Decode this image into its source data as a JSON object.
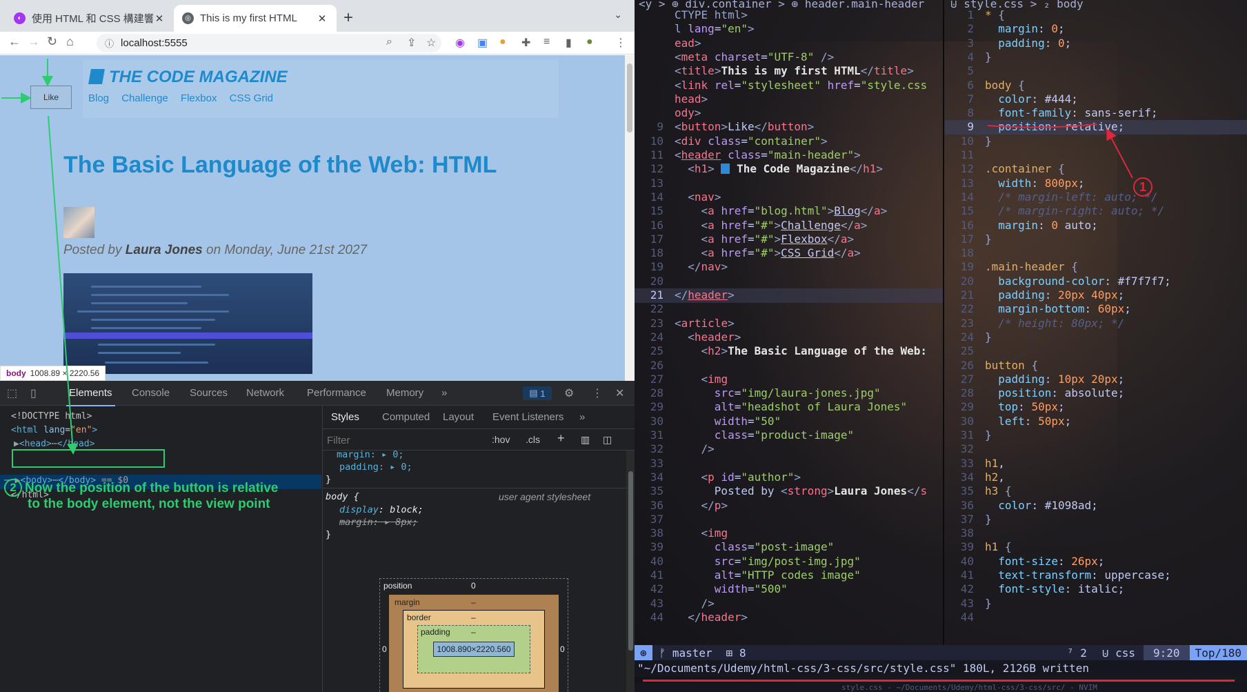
{
  "browser": {
    "tabs": [
      {
        "title": "使用 HTML 和 CSS 構建響",
        "close": "✕",
        "active": false
      },
      {
        "title": "This is my first HTML",
        "close": "✕",
        "active": true
      }
    ],
    "new_tab": "+",
    "tab_menu": "⌄",
    "url": "localhost:5555",
    "page": {
      "magazine_title": "The Code Magazine",
      "nav": [
        "Blog",
        "Challenge",
        "Flexbox",
        "CSS Grid"
      ],
      "like_button": "Like",
      "post_title": "The Basic Language of the Web: HTML",
      "posted_by": "Posted by",
      "author": "Laura Jones",
      "posted_on": "on Monday, June 21st 2027",
      "element_tooltip_tag": "body",
      "element_tooltip_size": "1008.89 × 2220.56"
    },
    "devtools": {
      "tabs": [
        "Elements",
        "Console",
        "Sources",
        "Network",
        "Performance",
        "Memory"
      ],
      "more": "»",
      "issues_count": "1",
      "dom": {
        "doctype": "<!DOCTYPE html>",
        "html_open_tag": "html",
        "html_lang_attr": "lang",
        "html_lang_value": "\"en\"",
        "head_tag": "head",
        "body_tag": "body",
        "body_suffix": "== $0",
        "html_close": "</html>"
      },
      "annotation_2_line1": "Now the position of the button is relative",
      "annotation_2_line2": "to the body element, not the view point",
      "annotation_2_num": "2",
      "styles_tabs": [
        "Styles",
        "Computed",
        "Layout",
        "Event Listeners"
      ],
      "filter_placeholder": "Filter",
      "hov": ":hov",
      "cls": ".cls",
      "rules": {
        "prev_margin": "margin: ▸ 0;",
        "prev_padding": "padding: ▸ 0;",
        "close": "}",
        "body_selector": "body {",
        "uas_label": "user agent stylesheet",
        "display_prop": "display",
        "display_val": "block;",
        "margin_struck": "margin: ▸ 8px;"
      },
      "box_model": {
        "position_label": "position",
        "position_value": "0",
        "margin_label": "margin",
        "border_label": "border",
        "padding_label": "padding",
        "dash": "–",
        "content": "1008.890×2220.560",
        "left_value": "0",
        "right_value": "0",
        "bottom_value": "0"
      }
    }
  },
  "editor": {
    "left_winbar": "<y > ⊕ div.container > ⊕ header.main-header",
    "right_winbar": "⊍ style.css > ₂ body",
    "html_lines": [
      {
        "n": "",
        "html": "<span class='c-br'>CTYPE html&gt;</span>"
      },
      {
        "n": "",
        "html": "<span class='c-br'>l</span> <span class='c-attr'>lang</span>=<span class='c-str'>\"en\"</span><span class='c-br'>&gt;</span>"
      },
      {
        "n": "",
        "html": "<span class='c-tag'>ead</span><span class='c-br'>&gt;</span>"
      },
      {
        "n": "",
        "html": "<span class='c-br'>&lt;</span><span class='c-tag'>meta</span> <span class='c-attr'>charset</span>=<span class='c-str'>\"UTF-8\"</span> <span class='c-br'>/&gt;</span>"
      },
      {
        "n": "",
        "html": "<span class='c-br'>&lt;</span><span class='c-tag'>title</span><span class='c-br'>&gt;</span><span class='c-text'>This is my first HTML</span><span class='c-br'>&lt;/</span><span class='c-tag'>title</span><span class='c-br'>&gt;</span>"
      },
      {
        "n": "",
        "html": "<span class='c-br'>&lt;</span><span class='c-tag'>link</span> <span class='c-attr'>rel</span>=<span class='c-str'>\"stylesheet\"</span> <span class='c-attr'>href</span>=<span class='c-str'>\"style.css</span>"
      },
      {
        "n": "",
        "html": "<span class='c-tag'>head</span><span class='c-br'>&gt;</span>"
      },
      {
        "n": "",
        "html": "<span class='c-tag'>ody</span><span class='c-br'>&gt;</span>"
      },
      {
        "n": "9",
        "html": "<span class='c-br'>&lt;</span><span class='c-tag'>button</span><span class='c-br'>&gt;</span><span class='c-kw'>Like</span><span class='c-br'>&lt;/</span><span class='c-tag'>button</span><span class='c-br'>&gt;</span>"
      },
      {
        "n": "10",
        "html": "<span class='c-br'>&lt;</span><span class='c-tag'>div</span> <span class='c-attr'>class</span>=<span class='c-str'>\"container\"</span><span class='c-br'>&gt;</span>"
      },
      {
        "n": "11",
        "html": "<span class='c-br'>&lt;</span><span class='c-tag' style='text-decoration:underline'>header</span> <span class='c-attr'>class</span>=<span class='c-str'>\"main-header\"</span><span class='c-br'>&gt;</span>"
      },
      {
        "n": "12",
        "html": "&nbsp;&nbsp;<span class='c-br'>&lt;</span><span class='c-tag'>h1</span><span class='c-br'>&gt;</span> <span style='display:inline-block;width:13px;height:15px;background:#2e8ad8;vertical-align:-2px'></span> <span class='c-text'>The Code Magazine</span><span class='c-br'>&lt;/</span><span class='c-tag'>h1</span><span class='c-br'>&gt;</span>"
      },
      {
        "n": "13",
        "html": ""
      },
      {
        "n": "14",
        "html": "&nbsp;&nbsp;<span class='c-br'>&lt;</span><span class='c-tag'>nav</span><span class='c-br'>&gt;</span>"
      },
      {
        "n": "15",
        "html": "&nbsp;&nbsp;&nbsp;&nbsp;<span class='c-br'>&lt;</span><span class='c-tag'>a</span> <span class='c-attr'>href</span>=<span class='c-str'>\"blog.html\"</span><span class='c-br'>&gt;</span><span class='c-link'>Blog</span><span class='c-br'>&lt;/</span><span class='c-tag'>a</span><span class='c-br'>&gt;</span>"
      },
      {
        "n": "16",
        "html": "&nbsp;&nbsp;&nbsp;&nbsp;<span class='c-br'>&lt;</span><span class='c-tag'>a</span> <span class='c-attr'>href</span>=<span class='c-str'>\"#\"</span><span class='c-br'>&gt;</span><span class='c-link'>Challenge</span><span class='c-br'>&lt;/</span><span class='c-tag'>a</span><span class='c-br'>&gt;</span>"
      },
      {
        "n": "17",
        "html": "&nbsp;&nbsp;&nbsp;&nbsp;<span class='c-br'>&lt;</span><span class='c-tag'>a</span> <span class='c-attr'>href</span>=<span class='c-str'>\"#\"</span><span class='c-br'>&gt;</span><span class='c-link'>Flexbox</span><span class='c-br'>&lt;/</span><span class='c-tag'>a</span><span class='c-br'>&gt;</span>"
      },
      {
        "n": "18",
        "html": "&nbsp;&nbsp;&nbsp;&nbsp;<span class='c-br'>&lt;</span><span class='c-tag'>a</span> <span class='c-attr'>href</span>=<span class='c-str'>\"#\"</span><span class='c-br'>&gt;</span><span class='c-link'>CSS Grid</span><span class='c-br'>&lt;/</span><span class='c-tag'>a</span><span class='c-br'>&gt;</span>"
      },
      {
        "n": "19",
        "html": "&nbsp;&nbsp;<span class='c-br'>&lt;/</span><span class='c-tag'>nav</span><span class='c-br'>&gt;</span>"
      },
      {
        "n": "20",
        "html": ""
      },
      {
        "n": "21",
        "html": "<span class='c-br'>&lt;/</span><span class='c-tag' style='text-decoration:underline'>header</span><span class='c-br'>&gt;</span>",
        "cur": true
      },
      {
        "n": "22",
        "html": ""
      },
      {
        "n": "23",
        "html": "<span class='c-br'>&lt;</span><span class='c-tag'>article</span><span class='c-br'>&gt;</span>"
      },
      {
        "n": "24",
        "html": "&nbsp;&nbsp;<span class='c-br'>&lt;</span><span class='c-tag'>header</span><span class='c-br'>&gt;</span>"
      },
      {
        "n": "25",
        "html": "&nbsp;&nbsp;&nbsp;&nbsp;<span class='c-br'>&lt;</span><span class='c-tag'>h2</span><span class='c-br'>&gt;</span><span class='c-text'>The Basic Language of the Web:</span>"
      },
      {
        "n": "26",
        "html": ""
      },
      {
        "n": "27",
        "html": "&nbsp;&nbsp;&nbsp;&nbsp;<span class='c-br'>&lt;</span><span class='c-tag'>img</span>"
      },
      {
        "n": "28",
        "html": "&nbsp;&nbsp;&nbsp;&nbsp;&nbsp;&nbsp;<span class='c-attr'>src</span>=<span class='c-str'>\"img/laura-jones.jpg\"</span>"
      },
      {
        "n": "29",
        "html": "&nbsp;&nbsp;&nbsp;&nbsp;&nbsp;&nbsp;<span class='c-attr'>alt</span>=<span class='c-str'>\"headshot of Laura Jones\"</span>"
      },
      {
        "n": "30",
        "html": "&nbsp;&nbsp;&nbsp;&nbsp;&nbsp;&nbsp;<span class='c-attr'>width</span>=<span class='c-str'>\"50\"</span>"
      },
      {
        "n": "31",
        "html": "&nbsp;&nbsp;&nbsp;&nbsp;&nbsp;&nbsp;<span class='c-attr'>class</span>=<span class='c-str'>\"product-image\"</span>"
      },
      {
        "n": "32",
        "html": "&nbsp;&nbsp;&nbsp;&nbsp;<span class='c-br'>/&gt;</span>"
      },
      {
        "n": "33",
        "html": ""
      },
      {
        "n": "34",
        "html": "&nbsp;&nbsp;&nbsp;&nbsp;<span class='c-br'>&lt;</span><span class='c-tag'>p</span> <span class='c-attr'>id</span>=<span class='c-str'>\"author\"</span><span class='c-br'>&gt;</span>"
      },
      {
        "n": "35",
        "html": "&nbsp;&nbsp;&nbsp;&nbsp;&nbsp;&nbsp;<span class='c-kw'>Posted by</span> <span class='c-br'>&lt;</span><span class='c-tag'>strong</span><span class='c-br'>&gt;</span><span class='c-text'>Laura Jones</span><span class='c-br'>&lt;/</span><span class='c-tag'>s</span>"
      },
      {
        "n": "36",
        "html": "&nbsp;&nbsp;&nbsp;&nbsp;<span class='c-br'>&lt;/</span><span class='c-tag'>p</span><span class='c-br'>&gt;</span>"
      },
      {
        "n": "37",
        "html": ""
      },
      {
        "n": "38",
        "html": "&nbsp;&nbsp;&nbsp;&nbsp;<span class='c-br'>&lt;</span><span class='c-tag'>img</span>"
      },
      {
        "n": "39",
        "html": "&nbsp;&nbsp;&nbsp;&nbsp;&nbsp;&nbsp;<span class='c-attr'>class</span>=<span class='c-str'>\"post-image\"</span>"
      },
      {
        "n": "40",
        "html": "&nbsp;&nbsp;&nbsp;&nbsp;&nbsp;&nbsp;<span class='c-attr'>src</span>=<span class='c-str'>\"img/post-img.jpg\"</span>"
      },
      {
        "n": "41",
        "html": "&nbsp;&nbsp;&nbsp;&nbsp;&nbsp;&nbsp;<span class='c-attr'>alt</span>=<span class='c-str'>\"HTTP codes image\"</span>"
      },
      {
        "n": "42",
        "html": "&nbsp;&nbsp;&nbsp;&nbsp;&nbsp;&nbsp;<span class='c-attr'>width</span>=<span class='c-str'>\"500\"</span>"
      },
      {
        "n": "43",
        "html": "&nbsp;&nbsp;&nbsp;&nbsp;<span class='c-br'>/&gt;</span>"
      },
      {
        "n": "44",
        "html": "&nbsp;&nbsp;<span class='c-br'>&lt;/</span><span class='c-tag'>header</span><span class='c-br'>&gt;</span>"
      }
    ],
    "css_lines": [
      {
        "n": "1",
        "html": "<span class='c-sel'>*</span> <span class='c-br'>{</span>"
      },
      {
        "n": "2",
        "html": "&nbsp;&nbsp;<span class='c-prop'>margin</span>: <span class='c-val'>0</span>;"
      },
      {
        "n": "3",
        "html": "&nbsp;&nbsp;<span class='c-prop'>padding</span>: <span class='c-val'>0</span>;"
      },
      {
        "n": "4",
        "html": "<span class='c-br'>}</span>"
      },
      {
        "n": "5",
        "html": ""
      },
      {
        "n": "6",
        "html": "<span class='c-sel'>body</span> <span class='c-br'>{</span>"
      },
      {
        "n": "7",
        "html": "&nbsp;&nbsp;<span class='c-prop'>color</span>: <span class='c-kw'>#444</span>;"
      },
      {
        "n": "8",
        "html": "&nbsp;&nbsp;<span class='c-prop'>font-family</span>: <span class='c-kw'>sans-serif</span>;"
      },
      {
        "n": "9",
        "html": "&nbsp;&nbsp;<span class='c-prop'>position</span>: <span class='c-kw'>relative</span>;",
        "cur": true
      },
      {
        "n": "10",
        "html": "<span class='c-br'>}</span>"
      },
      {
        "n": "11",
        "html": ""
      },
      {
        "n": "12",
        "html": "<span class='c-sel'>.container</span> <span class='c-br'>{</span>"
      },
      {
        "n": "13",
        "html": "&nbsp;&nbsp;<span class='c-prop'>width</span>: <span class='c-val'>800px</span>;"
      },
      {
        "n": "14",
        "html": "&nbsp;&nbsp;<span class='c-com'>/* margin-left: auto; */</span>"
      },
      {
        "n": "15",
        "html": "&nbsp;&nbsp;<span class='c-com'>/* margin-right: auto; */</span>"
      },
      {
        "n": "16",
        "html": "&nbsp;&nbsp;<span class='c-prop'>margin</span>: <span class='c-val'>0</span> <span class='c-kw'>auto</span>;"
      },
      {
        "n": "17",
        "html": "<span class='c-br'>}</span>"
      },
      {
        "n": "18",
        "html": ""
      },
      {
        "n": "19",
        "html": "<span class='c-sel'>.main-header</span> <span class='c-br'>{</span>"
      },
      {
        "n": "20",
        "html": "&nbsp;&nbsp;<span class='c-prop'>background-color</span>: <span class='c-kw'>#f7f7f7</span>;"
      },
      {
        "n": "21",
        "html": "&nbsp;&nbsp;<span class='c-prop'>padding</span>: <span class='c-val'>20px 40px</span>;"
      },
      {
        "n": "22",
        "html": "&nbsp;&nbsp;<span class='c-prop'>margin-bottom</span>: <span class='c-val'>60px</span>;"
      },
      {
        "n": "23",
        "html": "&nbsp;&nbsp;<span class='c-com'>/* height: 80px; */</span>"
      },
      {
        "n": "24",
        "html": "<span class='c-br'>}</span>"
      },
      {
        "n": "25",
        "html": ""
      },
      {
        "n": "26",
        "html": "<span class='c-sel'>button</span> <span class='c-br'>{</span>"
      },
      {
        "n": "27",
        "html": "&nbsp;&nbsp;<span class='c-prop'>padding</span>: <span class='c-val'>10px 20px</span>;"
      },
      {
        "n": "28",
        "html": "&nbsp;&nbsp;<span class='c-prop'>position</span>: <span class='c-kw'>absolute</span>;"
      },
      {
        "n": "29",
        "html": "&nbsp;&nbsp;<span class='c-prop'>top</span>: <span class='c-val'>50px</span>;"
      },
      {
        "n": "30",
        "html": "&nbsp;&nbsp;<span class='c-prop'>left</span>: <span class='c-val'>50px</span>;"
      },
      {
        "n": "31",
        "html": "<span class='c-br'>}</span>"
      },
      {
        "n": "32",
        "html": ""
      },
      {
        "n": "33",
        "html": "<span class='c-sel'>h1</span>,"
      },
      {
        "n": "34",
        "html": "<span class='c-sel'>h2</span>,"
      },
      {
        "n": "35",
        "html": "<span class='c-sel'>h3</span> <span class='c-br'>{</span>"
      },
      {
        "n": "36",
        "html": "&nbsp;&nbsp;<span class='c-prop'>color</span>: <span class='c-kw'>#1098ad</span>;"
      },
      {
        "n": "37",
        "html": "<span class='c-br'>}</span>"
      },
      {
        "n": "38",
        "html": ""
      },
      {
        "n": "39",
        "html": "<span class='c-sel'>h1</span> <span class='c-br'>{</span>"
      },
      {
        "n": "40",
        "html": "&nbsp;&nbsp;<span class='c-prop'>font-size</span>: <span class='c-val'>26px</span>;"
      },
      {
        "n": "41",
        "html": "&nbsp;&nbsp;<span class='c-prop'>text-transform</span>: <span class='c-kw'>uppercase</span>;"
      },
      {
        "n": "42",
        "html": "&nbsp;&nbsp;<span class='c-prop'>font-style</span>: <span class='c-kw'>italic</span>;"
      },
      {
        "n": "43",
        "html": "<span class='c-br'>}</span>"
      },
      {
        "n": "44",
        "html": ""
      }
    ],
    "annotation_1": "1",
    "statusline": {
      "mode": "⊛",
      "branch": "ᚠ master",
      "changes": "⊞ 8",
      "diag": "⁷ 2",
      "filetype": "⊍ css",
      "position": "9:20",
      "scroll": "Top/180"
    },
    "cmdline": "\"~/Documents/Udemy/html-css/3-css/src/style.css\" 180L, 2126B written",
    "bottom_tabline": "style.css - ~/Documents/Udemy/html-css/3-css/src/ - NVIM"
  }
}
